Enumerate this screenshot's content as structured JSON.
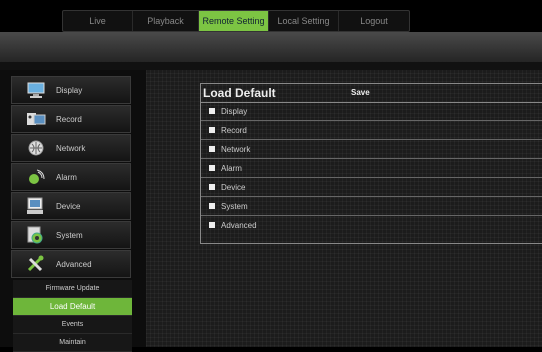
{
  "top_tabs": [
    "Live",
    "Playback",
    "Remote Setting",
    "Local Setting",
    "Logout"
  ],
  "active_tab": "Remote Setting",
  "sidebar": {
    "items": [
      {
        "label": "Display",
        "icon": "monitor-icon"
      },
      {
        "label": "Record",
        "icon": "record-icon"
      },
      {
        "label": "Network",
        "icon": "network-icon"
      },
      {
        "label": "Alarm",
        "icon": "alarm-icon"
      },
      {
        "label": "Device",
        "icon": "device-icon"
      },
      {
        "label": "System",
        "icon": "system-icon"
      },
      {
        "label": "Advanced",
        "icon": "tools-icon"
      }
    ],
    "sub_items": [
      "Firmware Update",
      "Load Default",
      "Events",
      "Maintain"
    ],
    "active_sub": "Load Default"
  },
  "panel": {
    "title": "Load Default",
    "save_label": "Save",
    "options": [
      "Display",
      "Record",
      "Network",
      "Alarm",
      "Device",
      "System",
      "Advanced"
    ]
  },
  "colors": {
    "accent": "#7cc443",
    "accent_active_sub": "#6eb63a"
  }
}
